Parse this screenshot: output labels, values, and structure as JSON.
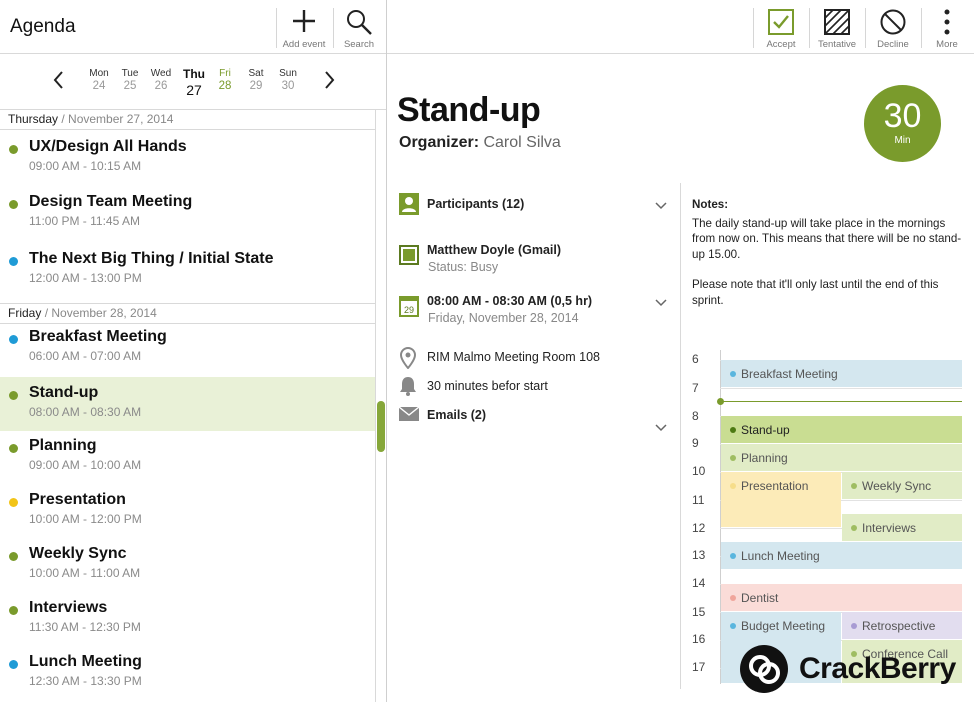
{
  "app": {
    "title": "Agenda"
  },
  "left_toolbar": {
    "add_event": "Add event",
    "search": "Search"
  },
  "right_toolbar": {
    "accept": "Accept",
    "tentative": "Tentative",
    "decline": "Decline",
    "more": "More"
  },
  "week": {
    "days": [
      {
        "name": "Mon",
        "date": "24"
      },
      {
        "name": "Tue",
        "date": "25"
      },
      {
        "name": "Wed",
        "date": "26"
      },
      {
        "name": "Thu",
        "date": "27"
      },
      {
        "name": "Fri",
        "date": "28"
      },
      {
        "name": "Sat",
        "date": "29"
      },
      {
        "name": "Sun",
        "date": "30"
      }
    ]
  },
  "agenda": {
    "sections": [
      {
        "day": "Thursday",
        "date": "/ November 27, 2014"
      },
      {
        "day": "Friday",
        "date": "/ November 28, 2014"
      }
    ],
    "events": [
      {
        "title": "UX/Design All Hands",
        "time": "09:00 AM - 10:15 AM",
        "color": "#7a9b2c"
      },
      {
        "title": "Design Team Meeting",
        "time": "11:00 PM - 11:45 AM",
        "color": "#7a9b2c"
      },
      {
        "title": "The Next Big Thing / Initial State",
        "time": "12:00 AM - 13:00 PM",
        "color": "#1f9bd6"
      },
      {
        "title": "Breakfast Meeting",
        "time": "06:00 AM - 07:00 AM",
        "color": "#1f9bd6"
      },
      {
        "title": "Stand-up",
        "time": "08:00 AM - 08:30 AM",
        "color": "#7a9b2c"
      },
      {
        "title": "Planning",
        "time": "09:00 AM - 10:00 AM",
        "color": "#7a9b2c"
      },
      {
        "title": "Presentation",
        "time": "10:00 AM - 12:00 PM",
        "color": "#f2c418"
      },
      {
        "title": "Weekly Sync",
        "time": "10:00 AM - 11:00 AM",
        "color": "#7a9b2c"
      },
      {
        "title": "Interviews",
        "time": "11:30 AM - 12:30 PM",
        "color": "#7a9b2c"
      },
      {
        "title": "Lunch Meeting",
        "time": "12:30 AM - 13:30 PM",
        "color": "#1f9bd6"
      }
    ]
  },
  "detail": {
    "title": "Stand-up",
    "organizer_label": "Organizer:",
    "organizer_name": "Carol Silva",
    "duration_value": "30",
    "duration_unit": "Min",
    "participants": "Participants (12)",
    "attendee_name": "Matthew Doyle (Gmail)",
    "attendee_status": "Status: Busy",
    "calendar_icon_date": "29",
    "time_range": "08:00 AM - 08:30 AM (0,5 hr)",
    "date": "Friday, November 28, 2014",
    "location": "RIM Malmo Meeting Room 108",
    "reminder": "30 minutes befor start",
    "emails": "Emails (2)"
  },
  "notes": {
    "header": "Notes:",
    "paragraph1": "The daily stand-up will take place in the mornings from now on. This means that there will be no stand-up 15.00.",
    "paragraph2": "Please note that it'll only last until the end of this sprint."
  },
  "day_calendar": {
    "hours": [
      "6",
      "7",
      "8",
      "9",
      "10",
      "11",
      "12",
      "13",
      "14",
      "15",
      "16",
      "17"
    ],
    "events": [
      {
        "title": "Breakfast Meeting",
        "bg": "#d4e7ef",
        "dot": "#5ab6de"
      },
      {
        "title": "Stand-up",
        "bg": "#c9dd92",
        "dot": "#4d7a12"
      },
      {
        "title": "Planning",
        "bg": "#e1ecc6",
        "dot": "#9fbd62"
      },
      {
        "title": "Presentation",
        "bg": "#fcebb8",
        "dot": "#f6dd8a"
      },
      {
        "title": "Weekly Sync",
        "bg": "#e1ecc6",
        "dot": "#9fbd62"
      },
      {
        "title": "Interviews",
        "bg": "#e1ecc6",
        "dot": "#9fbd62"
      },
      {
        "title": "Lunch Meeting",
        "bg": "#d4e7ef",
        "dot": "#5ab6de"
      },
      {
        "title": "Dentist",
        "bg": "#fadcd8",
        "dot": "#f0a59b"
      },
      {
        "title": "Budget Meeting",
        "bg": "#d4e7ef",
        "dot": "#5ab6de"
      },
      {
        "title": "Retrospective",
        "bg": "#e2ddef",
        "dot": "#a89bd3"
      },
      {
        "title": "Conference Call",
        "bg": "#e1ecc6",
        "dot": "#9fbd62"
      }
    ]
  },
  "watermark": {
    "text": "CrackBerry"
  },
  "colors": {
    "accent": "#7a9b2c",
    "selected_row": "#e9f1d7"
  }
}
